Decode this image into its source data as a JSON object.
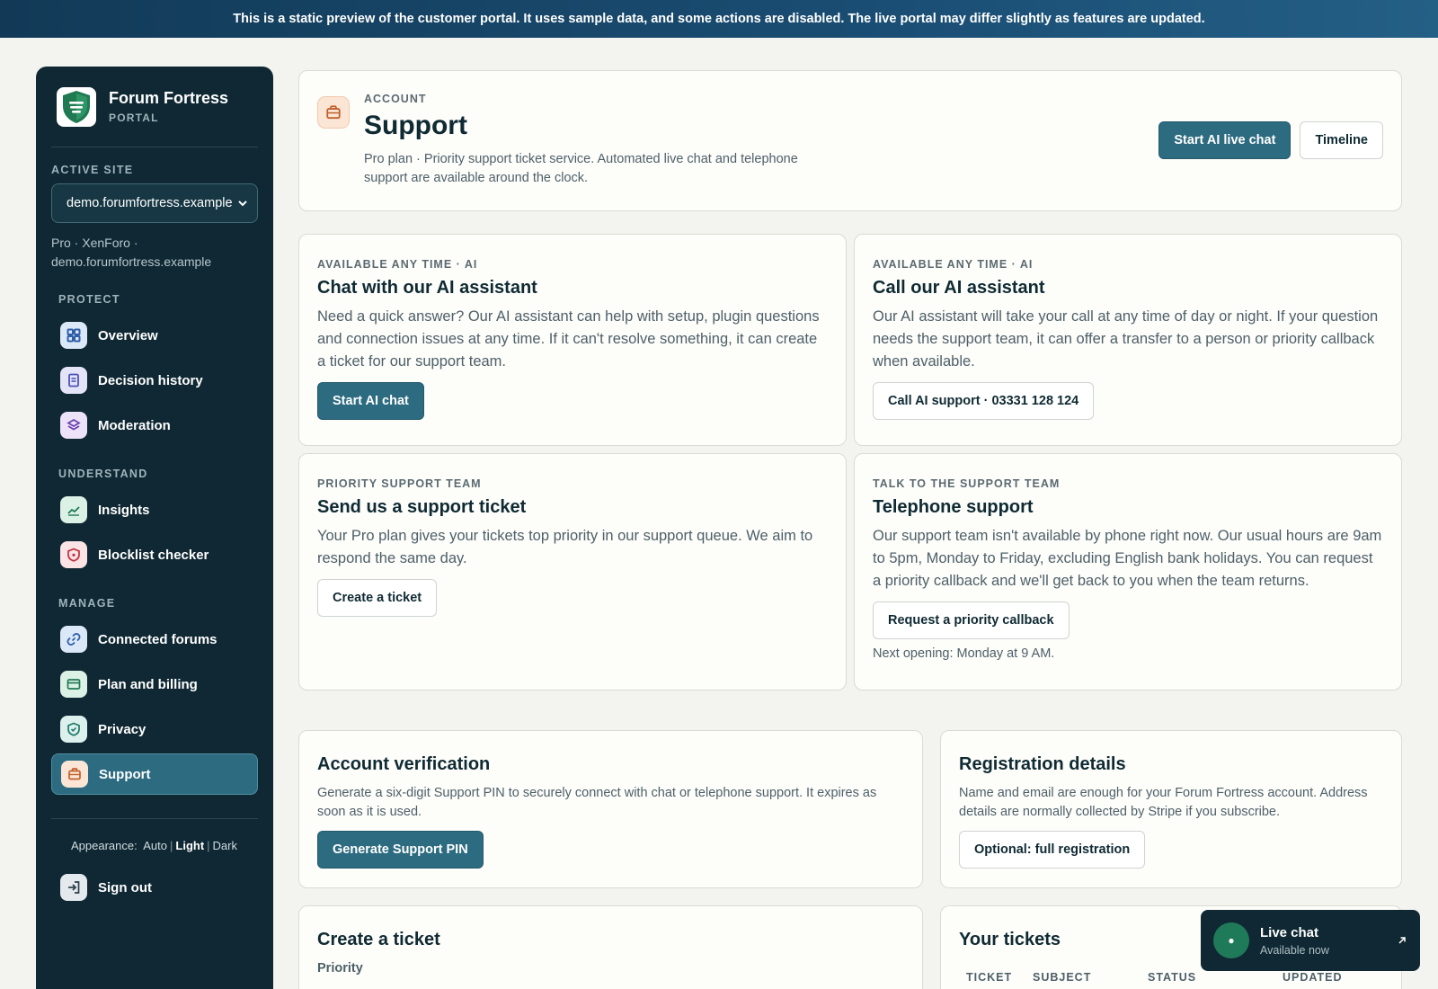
{
  "banner": "This is a static preview of the customer portal. It uses sample data, and some actions are disabled. The live portal may differ slightly as features are updated.",
  "brand": {
    "name": "Forum Fortress",
    "sub": "PORTAL"
  },
  "active_site": {
    "label": "ACTIVE SITE",
    "selected": "demo.forumfortress.example",
    "info": "Pro · XenForo · demo.forumfortress.example"
  },
  "nav": {
    "protect": {
      "label": "PROTECT",
      "items": [
        {
          "label": "Overview",
          "icon": "grid-icon",
          "bg": "#dbe8f7",
          "fg": "#2f5ea8"
        },
        {
          "label": "Decision history",
          "icon": "document-icon",
          "bg": "#e3e4f8",
          "fg": "#4d52b5"
        },
        {
          "label": "Moderation",
          "icon": "layers-icon",
          "bg": "#ece3f8",
          "fg": "#6b3fb0"
        }
      ]
    },
    "understand": {
      "label": "UNDERSTAND",
      "items": [
        {
          "label": "Insights",
          "icon": "chart-line-icon",
          "bg": "#dcf1e6",
          "fg": "#1f7a52"
        },
        {
          "label": "Blocklist checker",
          "icon": "shield-alert-icon",
          "bg": "#fbe3e6",
          "fg": "#c0303f"
        }
      ]
    },
    "manage": {
      "label": "MANAGE",
      "items": [
        {
          "label": "Connected forums",
          "icon": "link-icon",
          "bg": "#dbe8f7",
          "fg": "#2f5ea8"
        },
        {
          "label": "Plan and billing",
          "icon": "credit-card-icon",
          "bg": "#dcf1e6",
          "fg": "#1f7a52"
        },
        {
          "label": "Privacy",
          "icon": "shield-check-icon",
          "bg": "#dcf1ee",
          "fg": "#1f7a6a"
        },
        {
          "label": "Support",
          "icon": "briefcase-icon",
          "bg": "#fbe6d6",
          "fg": "#c0602c"
        }
      ]
    }
  },
  "appearance": {
    "label": "Appearance:",
    "auto": "Auto",
    "light": "Light",
    "dark": "Dark"
  },
  "sign_out": "Sign out",
  "header": {
    "kicker": "ACCOUNT",
    "title": "Support",
    "desc": "Pro plan · Priority support ticket service. Automated live chat and telephone support are available around the clock.",
    "primary": "Start AI live chat",
    "secondary": "Timeline"
  },
  "cards": {
    "chat": {
      "kicker": "AVAILABLE ANY TIME · AI",
      "title": "Chat with our AI assistant",
      "body": "Need a quick answer? Our AI assistant can help with setup, plugin questions and connection issues at any time. If it can't resolve something, it can create a ticket for our support team.",
      "button": "Start AI chat"
    },
    "call": {
      "kicker": "AVAILABLE ANY TIME · AI",
      "title": "Call our AI assistant",
      "body": "Our AI assistant will take your call at any time of day or night. If your question needs the support team, it can offer a transfer to a person or priority callback when available.",
      "button": "Call AI support · 03331 128 124"
    },
    "ticket": {
      "kicker": "PRIORITY SUPPORT TEAM",
      "title": "Send us a support ticket",
      "body": "Your Pro plan gives your tickets top priority in our support queue. We aim to respond the same day.",
      "button": "Create a ticket"
    },
    "phone": {
      "kicker": "TALK TO THE SUPPORT TEAM",
      "title": "Telephone support",
      "body": "Our support team isn't available by phone right now. Our usual hours are 9am to 5pm, Monday to Friday, excluding English bank holidays. You can request a priority callback and we'll get back to you when the team returns.",
      "button": "Request a priority callback",
      "note": "Next opening: Monday at 9 AM."
    }
  },
  "verification": {
    "title": "Account verification",
    "body": "Generate a six-digit Support PIN to securely connect with chat or telephone support. It expires as soon as it is used.",
    "button": "Generate Support PIN"
  },
  "registration": {
    "title": "Registration details",
    "body": "Name and email are enough for your Forum Fortress account. Address details are normally collected by Stripe if you subscribe.",
    "button": "Optional: full registration"
  },
  "create_ticket": {
    "title": "Create a ticket",
    "priority_label": "Priority"
  },
  "your_tickets": {
    "title": "Your tickets",
    "columns": [
      "TICKET",
      "SUBJECT",
      "STATUS",
      "UPDATED"
    ]
  },
  "live_chat": {
    "title": "Live chat",
    "sub": "Available now"
  }
}
